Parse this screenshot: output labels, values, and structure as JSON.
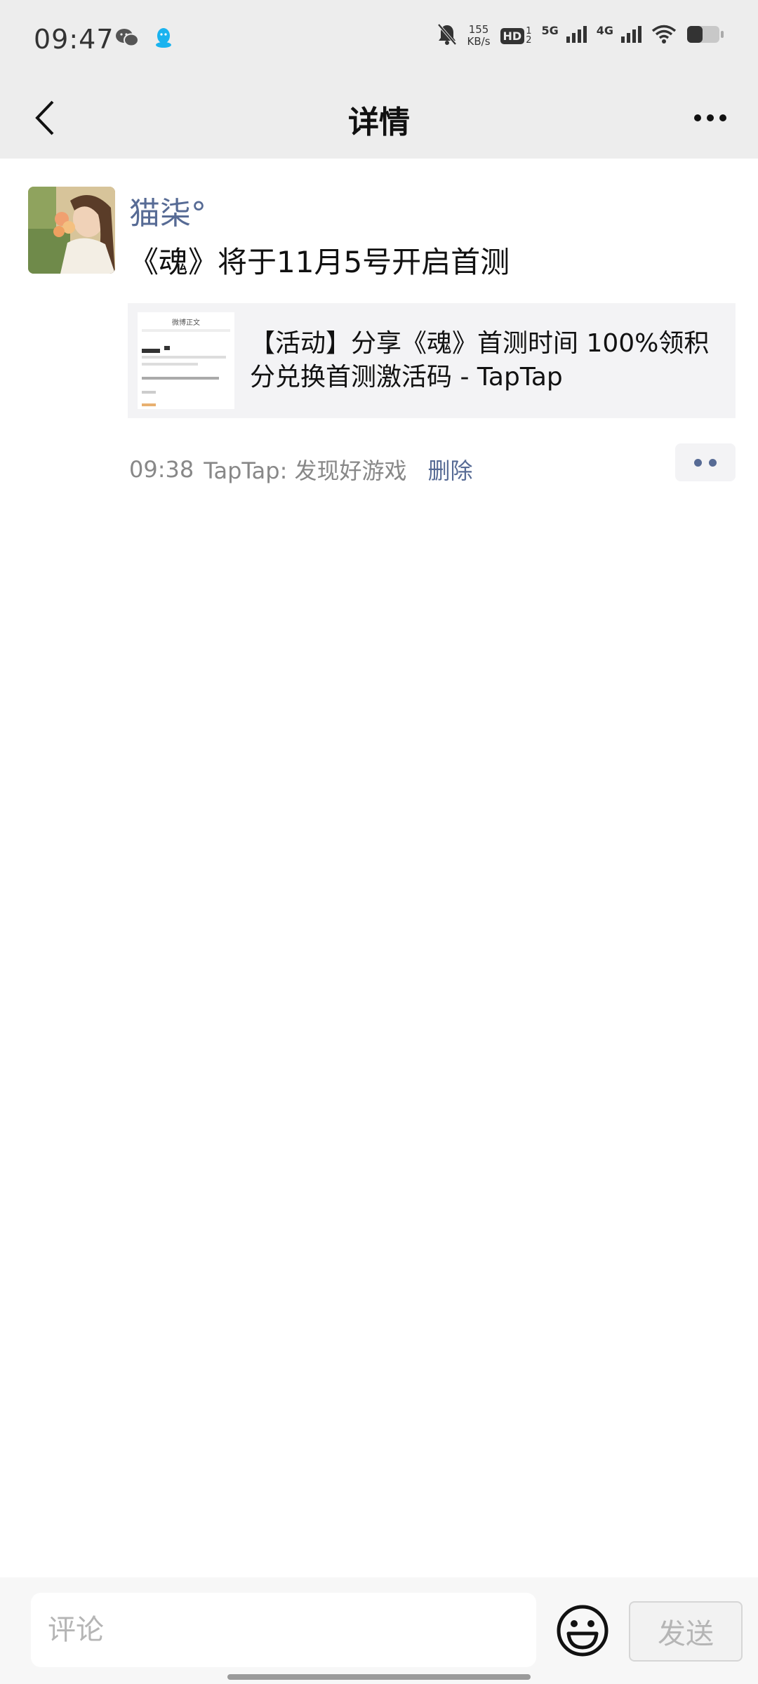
{
  "status_bar": {
    "time": "09:47",
    "net_speed_value": "155",
    "net_speed_unit": "KB/s",
    "hd_label": "HD",
    "hd_sim1": "1",
    "hd_sim2": "2",
    "sim1_network": "5G",
    "sim2_network": "4G",
    "left_icons": [
      "wechat-icon",
      "qq-icon"
    ],
    "right_icons": [
      "mute-bell-icon",
      "signal-icon",
      "signal-icon",
      "wifi-icon",
      "battery-icon"
    ]
  },
  "nav": {
    "title": "详情",
    "back_icon": "chevron-left-icon",
    "more_icon": "more-dots-icon"
  },
  "post": {
    "username": "猫柒°",
    "text": "《魂》将于11月5号开启首测",
    "link_card": {
      "title": "【活动】分享《魂》首测时间 100%领积分兑换首测激活码 - TapTap",
      "thumbnail_text": "微博正文"
    },
    "time": "09:38",
    "source": "TapTap: 发现好游戏",
    "delete_label": "删除"
  },
  "comment_bar": {
    "placeholder": "评论",
    "emoji_icon": "smiley-face-icon",
    "send_label": "发送"
  },
  "colors": {
    "header_bg": "#ededed",
    "link_blue": "#576b95",
    "card_bg": "#f3f3f5"
  }
}
